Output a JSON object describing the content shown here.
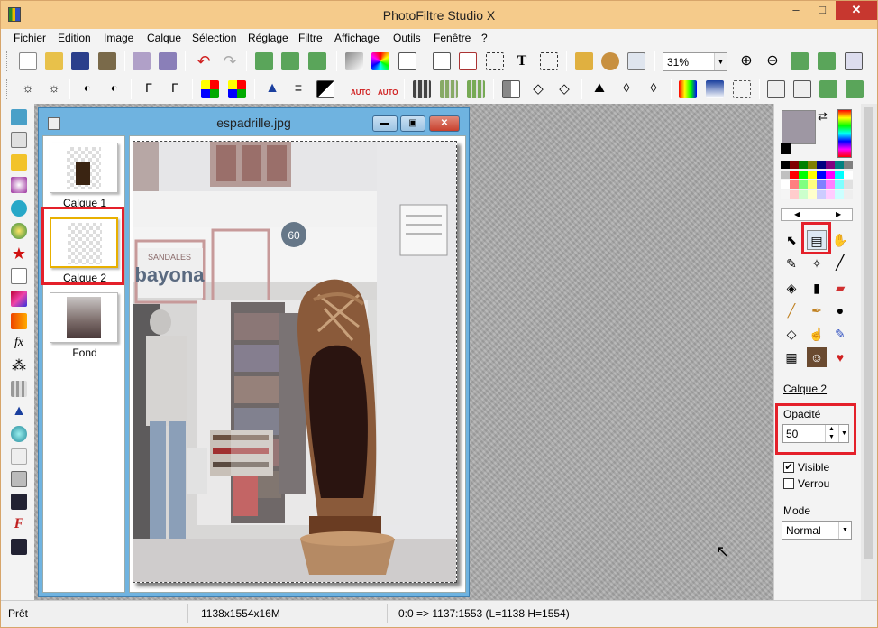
{
  "app": {
    "title": "PhotoFiltre Studio X"
  },
  "window_controls": {
    "minimize": "–",
    "maximize": "□",
    "close": "✕"
  },
  "menu": [
    "Fichier",
    "Edition",
    "Image",
    "Calque",
    "Sélection",
    "Réglage",
    "Filtre",
    "Affichage",
    "Outils",
    "Fenêtre",
    "?"
  ],
  "toolbar": {
    "zoom": "31%"
  },
  "document": {
    "title": "espadrille.jpg",
    "layers": [
      {
        "name": "Calque 1"
      },
      {
        "name": "Calque 2"
      },
      {
        "name": "Fond"
      }
    ],
    "photo_signs": {
      "shop_top": "SANDALES",
      "shop_name": "bayona",
      "number": "60"
    }
  },
  "right_panel": {
    "active_layer": "Calque 2",
    "opacity_label": "Opacité",
    "opacity_value": "50",
    "visible_label": "Visible",
    "visible_checked": true,
    "lock_label": "Verrou",
    "lock_checked": false,
    "mode_label": "Mode",
    "mode_value": "Normal",
    "current_color": "#9e97a3"
  },
  "status": {
    "state": "Prêt",
    "size": "1138x1554x16M",
    "coords": "0:0 => 1137:1553 (L=1138  H=1554)"
  }
}
